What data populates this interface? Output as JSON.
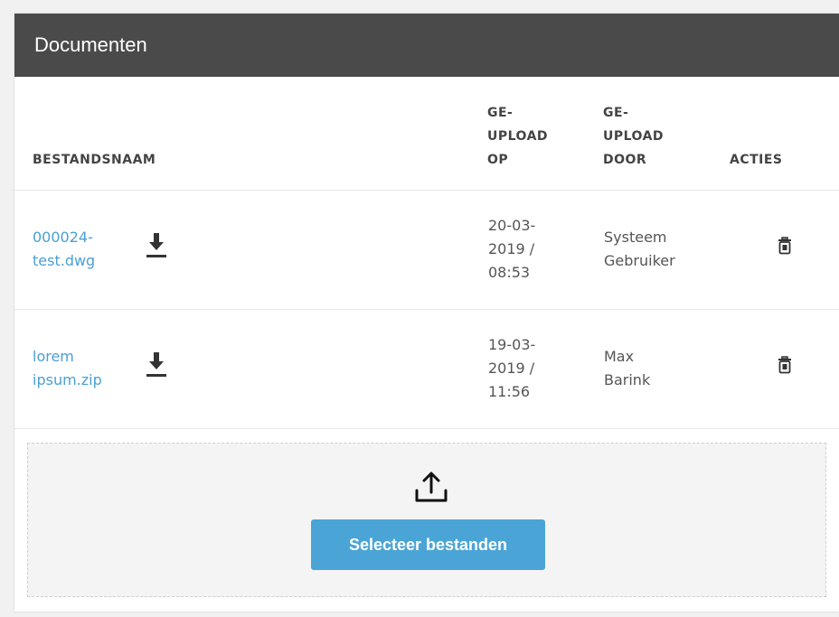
{
  "panel": {
    "title": "Documenten"
  },
  "table": {
    "headers": {
      "name": "BESTANDSNAAM",
      "uploaded_on": [
        "GE-",
        "UPLOAD",
        "OP"
      ],
      "uploaded_by": [
        "GE-",
        "UPLOAD",
        "DOOR"
      ],
      "actions": "ACTIES"
    },
    "rows": [
      {
        "file": [
          "000024-",
          "test.dwg"
        ],
        "date": [
          "20-03-",
          "2019 /",
          "08:53"
        ],
        "user": [
          "Systeem",
          "Gebruiker"
        ],
        "download_icon": "download-icon",
        "delete_icon": "trash-icon"
      },
      {
        "file": [
          "lorem",
          "ipsum.zip"
        ],
        "date": [
          "19-03-",
          "2019 /",
          "11:56"
        ],
        "user": [
          "Max",
          "Barink"
        ],
        "download_icon": "download-icon",
        "delete_icon": "trash-icon"
      }
    ]
  },
  "upload": {
    "icon": "upload-icon",
    "button_label": "Selecteer bestanden"
  },
  "colors": {
    "header_bg": "#4a4a4a",
    "link": "#4a9fd4",
    "button": "#4aa5d6"
  }
}
